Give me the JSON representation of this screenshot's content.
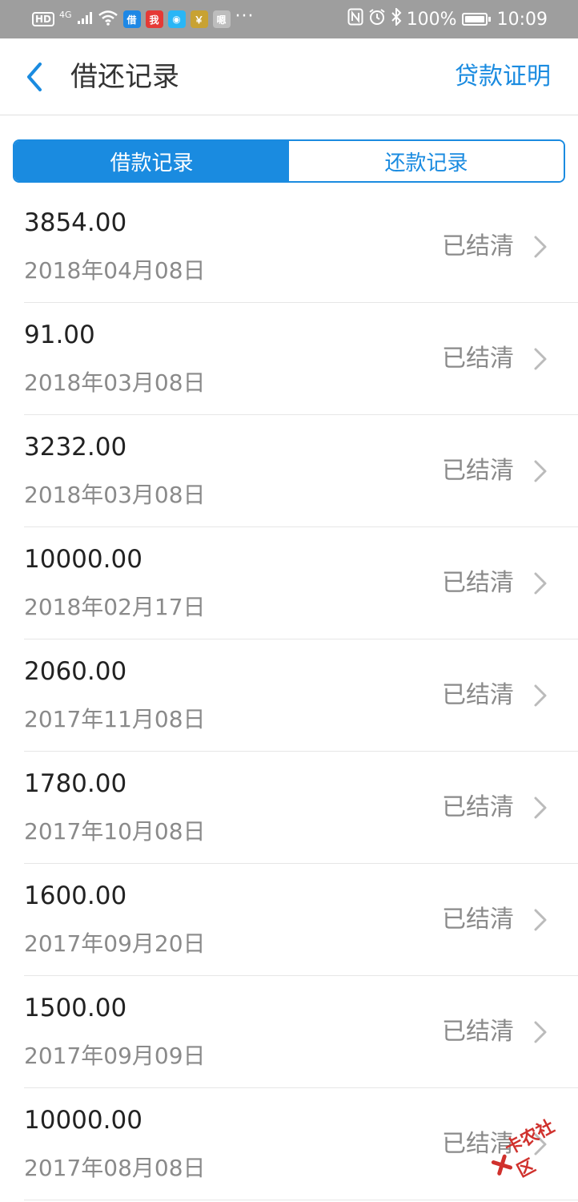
{
  "status_bar": {
    "left_badge": "HD",
    "network": "4G",
    "app_icons": [
      {
        "name": "jie-app-icon",
        "glyph": "借",
        "color": "#1e88e5"
      },
      {
        "name": "red-app-icon",
        "glyph": "我",
        "color": "#e53935"
      },
      {
        "name": "blue-app-icon",
        "glyph": "◉",
        "color": "#29b6f6"
      },
      {
        "name": "bag-app-icon",
        "glyph": "￥",
        "color": "#c8a233"
      },
      {
        "name": "message-app-icon",
        "glyph": "嗯",
        "color": "#bdbdbd"
      }
    ],
    "more": "···",
    "battery": "100%",
    "time": "10:09"
  },
  "header": {
    "title": "借还记录",
    "action": "贷款证明"
  },
  "tabs": [
    {
      "label": "借款记录",
      "active": true
    },
    {
      "label": "还款记录",
      "active": false
    }
  ],
  "records": [
    {
      "amount": "3854.00",
      "date": "2018年04月08日",
      "status": "已结清"
    },
    {
      "amount": "91.00",
      "date": "2018年03月08日",
      "status": "已结清"
    },
    {
      "amount": "3232.00",
      "date": "2018年03月08日",
      "status": "已结清"
    },
    {
      "amount": "10000.00",
      "date": "2018年02月17日",
      "status": "已结清"
    },
    {
      "amount": "2060.00",
      "date": "2017年11月08日",
      "status": "已结清"
    },
    {
      "amount": "1780.00",
      "date": "2017年10月08日",
      "status": "已结清"
    },
    {
      "amount": "1600.00",
      "date": "2017年09月20日",
      "status": "已结清"
    },
    {
      "amount": "1500.00",
      "date": "2017年09月09日",
      "status": "已结清"
    },
    {
      "amount": "10000.00",
      "date": "2017年08月08日",
      "status": "已结清"
    }
  ],
  "watermark": {
    "text": "卡农社区"
  },
  "colors": {
    "accent": "#1a8be0",
    "status_bar": "#9e9e9e",
    "muted_text": "#8a8a8a"
  }
}
